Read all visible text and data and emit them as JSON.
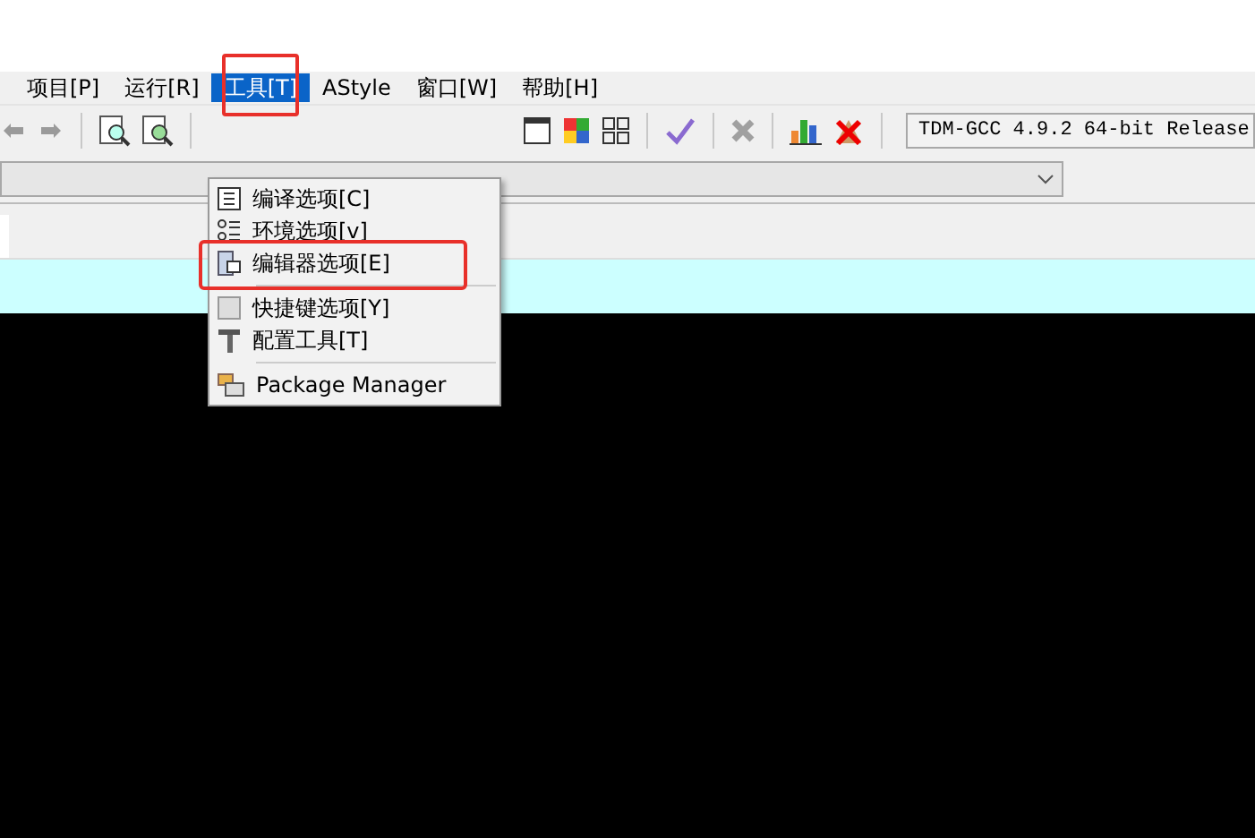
{
  "menubar": {
    "items": [
      {
        "label": "项目[P]",
        "selected": false,
        "highlighted": false
      },
      {
        "label": "运行[R]",
        "selected": false,
        "highlighted": false
      },
      {
        "label": "工具[T]",
        "selected": true,
        "highlighted": true
      },
      {
        "label": "AStyle",
        "selected": false,
        "highlighted": false
      },
      {
        "label": "窗口[W]",
        "selected": false,
        "highlighted": false
      },
      {
        "label": "帮助[H]",
        "selected": false,
        "highlighted": false
      }
    ]
  },
  "toolbar": {
    "compiler": "TDM-GCC 4.9.2 64-bit Release"
  },
  "menu": {
    "items": [
      {
        "kind": "item",
        "label": "编译选项[C]",
        "highlighted": false
      },
      {
        "kind": "item",
        "label": "环境选项[v]",
        "highlighted": false
      },
      {
        "kind": "item",
        "label": "编辑器选项[E]",
        "highlighted": true
      },
      {
        "kind": "separator"
      },
      {
        "kind": "item",
        "label": "快捷键选项[Y]",
        "highlighted": false
      },
      {
        "kind": "item",
        "label": "配置工具[T]",
        "highlighted": false
      },
      {
        "kind": "separator"
      },
      {
        "kind": "item",
        "label": "Package Manager",
        "highlighted": false
      }
    ]
  }
}
